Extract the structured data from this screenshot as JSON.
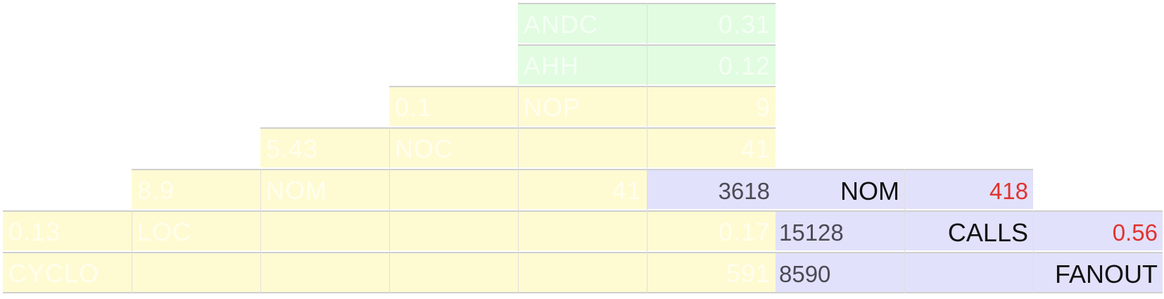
{
  "pyramid": {
    "rows": [
      {
        "band_color": "#e1fce1",
        "labels": [
          "ANDC",
          "0.31"
        ]
      },
      {
        "band_color": "#e1fce1",
        "labels": [
          "AHH",
          "0.12"
        ]
      },
      {
        "band_color": "#fefbd2",
        "labels": [
          "0.1",
          "NOP",
          "9"
        ]
      },
      {
        "band_color": "#fefbd2",
        "labels": [
          "5.43",
          "NOC",
          "41"
        ]
      },
      {
        "band_color": "#fefbd2",
        "labels": [
          "8.9",
          "NOM",
          "41"
        ]
      },
      {
        "band_color": "#fefbd2",
        "labels": [
          "0.13",
          "LOC",
          "0.17"
        ]
      },
      {
        "band_color": "#fefbd2",
        "labels": [
          "CYCLO",
          "591"
        ]
      }
    ]
  },
  "metrics": {
    "band_color": "#e1e1fb",
    "nom": {
      "value": "3618",
      "label": "NOM",
      "ratio": "418"
    },
    "calls": {
      "value": "15128",
      "label": "CALLS",
      "ratio": "0.56"
    },
    "fanout": {
      "value": "8590",
      "label": "FANOUT"
    }
  },
  "colors": {
    "ratio_red": "#e0332e",
    "number_gray": "#4a4a55",
    "separator_gray": "#cfcfcf"
  }
}
